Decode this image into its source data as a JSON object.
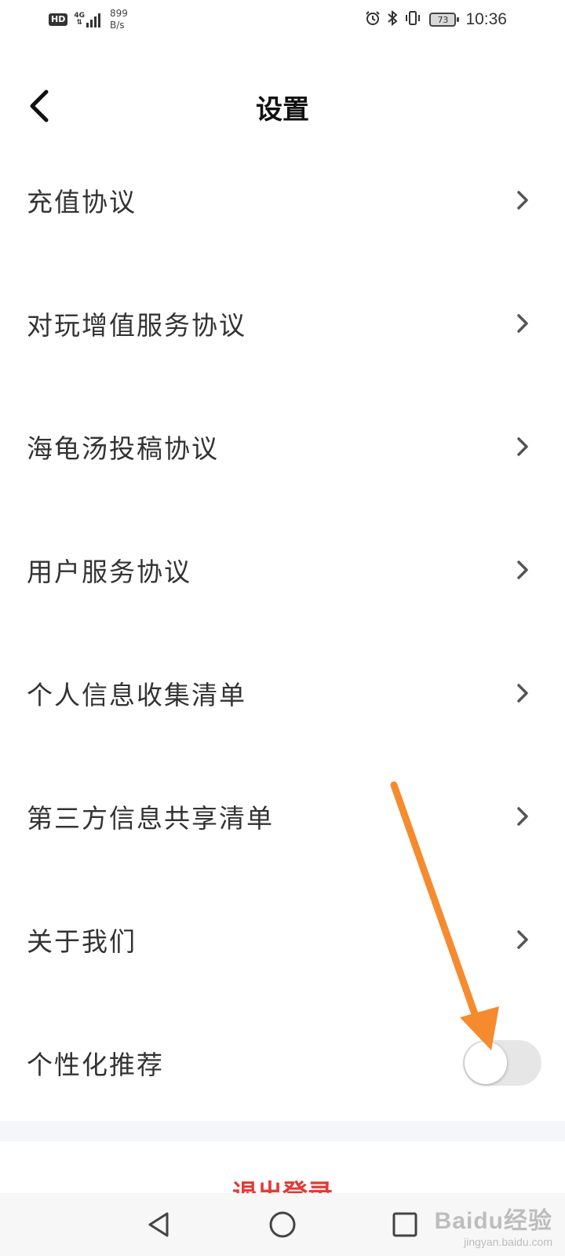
{
  "status_bar": {
    "hd": "HD",
    "network_type": "4G",
    "network_arrows": "⇅",
    "speed_value": "899",
    "speed_unit": "B/s",
    "battery_level": "73",
    "time": "10:36",
    "icons": [
      "alarm-icon",
      "bluetooth-icon",
      "vibrate-icon",
      "battery-icon"
    ]
  },
  "header": {
    "title": "设置",
    "back_icon": "chevron-left-icon"
  },
  "settings": {
    "items": [
      {
        "label": "充值协议"
      },
      {
        "label": "对玩增值服务协议"
      },
      {
        "label": "海龟汤投稿协议"
      },
      {
        "label": "用户服务协议"
      },
      {
        "label": "个人信息收集清单"
      },
      {
        "label": "第三方信息共享清单"
      },
      {
        "label": "关于我们"
      }
    ],
    "toggle_item": {
      "label": "个性化推荐",
      "enabled": false
    }
  },
  "logout": {
    "label": "退出登录",
    "color": "#e53935"
  },
  "nav_bar": {
    "icons": [
      "back-triangle-icon",
      "home-circle-icon",
      "recents-square-icon"
    ]
  },
  "watermark": {
    "brand": "Baidu经验",
    "url": "jingyan.baidu.com"
  },
  "annotation": {
    "arrow_color": "#f58b2e"
  }
}
